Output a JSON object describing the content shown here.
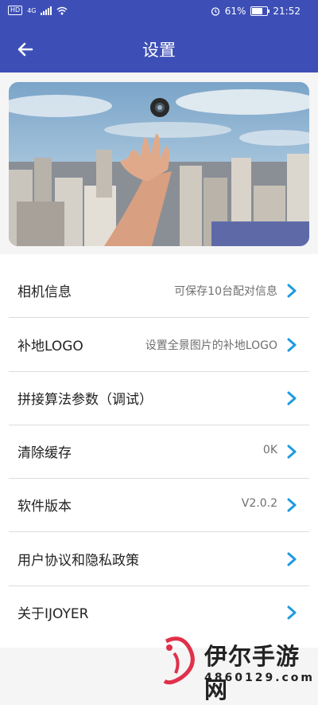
{
  "status_bar": {
    "net": "HD",
    "signal_type": "4G",
    "battery": "61%",
    "time": "21:52"
  },
  "header": {
    "title": "设置",
    "background": "#3d4fb7"
  },
  "banner": {
    "description": "hand reaching toward floating camera above city"
  },
  "settings": {
    "items": [
      {
        "label": "相机信息",
        "value": "可保存10台配对信息"
      },
      {
        "label": "补地LOGO",
        "value": "设置全景图片的补地LOGO"
      },
      {
        "label": "拼接算法参数（调试）",
        "value": ""
      },
      {
        "label": "清除缓存",
        "value": "0K"
      },
      {
        "label": "软件版本",
        "value": "V2.0.2"
      },
      {
        "label": "用户协议和隐私政策",
        "value": ""
      },
      {
        "label": "关于IJOYER",
        "value": ""
      }
    ],
    "chevron_color": "#1e9be0"
  },
  "watermark": {
    "name": "伊尔手游网",
    "site": "4860129.com"
  }
}
